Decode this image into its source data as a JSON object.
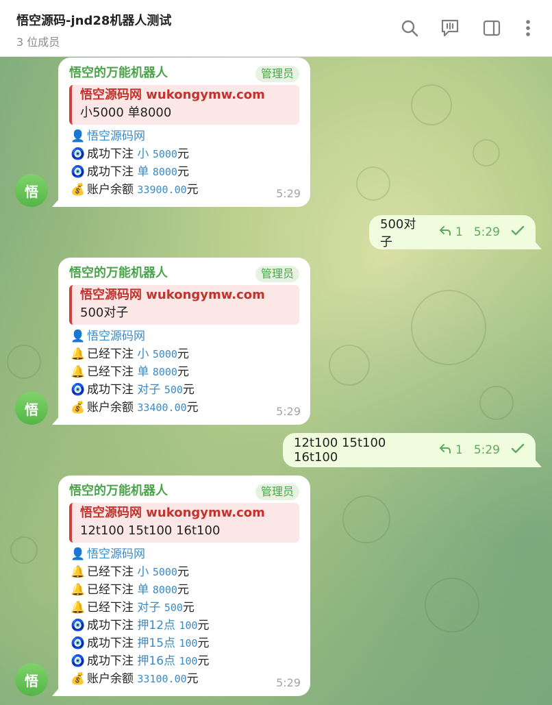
{
  "header": {
    "title": "悟空源码-jnd28机器人测试",
    "subtitle": "3 位成员",
    "icons": [
      "search-icon",
      "voice-chat-icon",
      "sidebar-toggle-icon",
      "more-icon"
    ]
  },
  "avatar": {
    "letter": "悟"
  },
  "messages": [
    {
      "type": "in",
      "sender": "悟空的万能机器人",
      "role": "管理员",
      "quote_title": "悟空源码网 wukongymw.com",
      "quote_text": "小5000 单8000",
      "user_line": "悟空源码网",
      "lines": [
        {
          "emoji": "🧿",
          "prefix": "成功下注 ",
          "accent": "小 ",
          "amount": "5000",
          "suffix": "元"
        },
        {
          "emoji": "🧿",
          "prefix": "成功下注 ",
          "accent": "单 ",
          "amount": "8000",
          "suffix": "元"
        },
        {
          "emoji": "💰",
          "prefix": "账户余额 ",
          "accent": "",
          "amount": "33900.00",
          "suffix": "元"
        }
      ],
      "time": "5:29"
    },
    {
      "type": "out",
      "text": "500对子",
      "reply_count": "1",
      "time": "5:29"
    },
    {
      "type": "in",
      "sender": "悟空的万能机器人",
      "role": "管理员",
      "quote_title": "悟空源码网 wukongymw.com",
      "quote_text": "500对子",
      "user_line": "悟空源码网",
      "lines": [
        {
          "emoji": "🔔",
          "prefix": "已经下注 ",
          "accent": "小 ",
          "amount": "5000",
          "suffix": "元"
        },
        {
          "emoji": "🔔",
          "prefix": "已经下注 ",
          "accent": "单 ",
          "amount": "8000",
          "suffix": "元"
        },
        {
          "emoji": "🧿",
          "prefix": "成功下注 ",
          "accent": "对子 ",
          "amount": "500",
          "suffix": "元"
        },
        {
          "emoji": "💰",
          "prefix": "账户余额 ",
          "accent": "",
          "amount": "33400.00",
          "suffix": "元"
        }
      ],
      "time": "5:29"
    },
    {
      "type": "out",
      "text": "12t100 15t100 16t100",
      "reply_count": "1",
      "time": "5:29"
    },
    {
      "type": "in",
      "sender": "悟空的万能机器人",
      "role": "管理员",
      "quote_title": "悟空源码网 wukongymw.com",
      "quote_text": "12t100 15t100 16t100",
      "user_line": "悟空源码网",
      "lines": [
        {
          "emoji": "🔔",
          "prefix": "已经下注 ",
          "accent": "小 ",
          "amount": "5000",
          "suffix": "元"
        },
        {
          "emoji": "🔔",
          "prefix": "已经下注 ",
          "accent": "单 ",
          "amount": "8000",
          "suffix": "元"
        },
        {
          "emoji": "🔔",
          "prefix": "已经下注 ",
          "accent": "对子 ",
          "amount": "500",
          "suffix": "元"
        },
        {
          "emoji": "🧿",
          "prefix": "成功下注 ",
          "accent": "押12点 ",
          "amount": "100",
          "suffix": "元"
        },
        {
          "emoji": "🧿",
          "prefix": "成功下注 ",
          "accent": "押15点 ",
          "amount": "100",
          "suffix": "元"
        },
        {
          "emoji": "🧿",
          "prefix": "成功下注 ",
          "accent": "押16点 ",
          "amount": "100",
          "suffix": "元"
        },
        {
          "emoji": "💰",
          "prefix": "账户余额 ",
          "accent": "",
          "amount": "33100.00",
          "suffix": "元"
        }
      ],
      "time": "5:29"
    }
  ]
}
